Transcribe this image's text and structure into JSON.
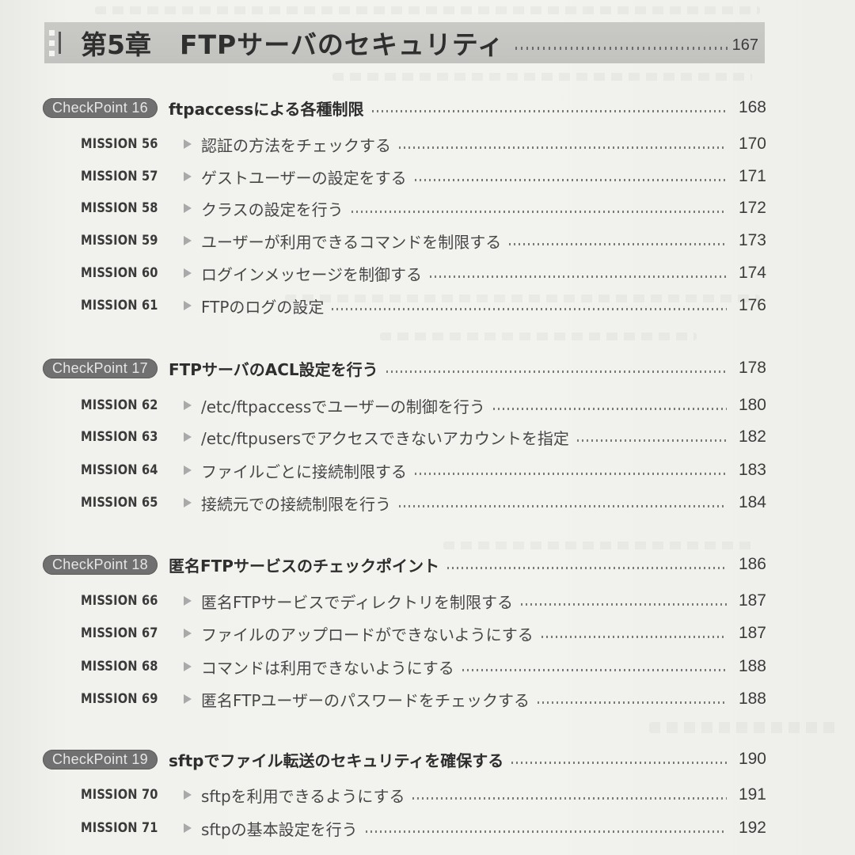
{
  "chapter": {
    "number_label": "第5章",
    "title": "FTPサーバのセキュリティ",
    "page": "167"
  },
  "checkpoints": [
    {
      "badge": "CheckPoint 16",
      "title": "ftpaccessによる各種制限",
      "page": "168",
      "missions": [
        {
          "label": "MISSION 56",
          "title": "認証の方法をチェックする",
          "page": "170"
        },
        {
          "label": "MISSION 57",
          "title": "ゲストユーザーの設定をする",
          "page": "171"
        },
        {
          "label": "MISSION 58",
          "title": "クラスの設定を行う",
          "page": "172"
        },
        {
          "label": "MISSION 59",
          "title": "ユーザーが利用できるコマンドを制限する",
          "page": "173"
        },
        {
          "label": "MISSION 60",
          "title": "ログインメッセージを制御する",
          "page": "174"
        },
        {
          "label": "MISSION 61",
          "title": "FTPのログの設定",
          "page": "176"
        }
      ]
    },
    {
      "badge": "CheckPoint 17",
      "title": "FTPサーバのACL設定を行う",
      "page": "178",
      "missions": [
        {
          "label": "MISSION 62",
          "title": "/etc/ftpaccessでユーザーの制御を行う",
          "page": "180"
        },
        {
          "label": "MISSION 63",
          "title": "/etc/ftpusersでアクセスできないアカウントを指定",
          "page": "182"
        },
        {
          "label": "MISSION 64",
          "title": "ファイルごとに接続制限する",
          "page": "183"
        },
        {
          "label": "MISSION 65",
          "title": "接続元での接続制限を行う",
          "page": "184"
        }
      ]
    },
    {
      "badge": "CheckPoint 18",
      "title": "匿名FTPサービスのチェックポイント",
      "page": "186",
      "missions": [
        {
          "label": "MISSION 66",
          "title": "匿名FTPサービスでディレクトリを制限する",
          "page": "187"
        },
        {
          "label": "MISSION 67",
          "title": "ファイルのアップロードができないようにする",
          "page": "187"
        },
        {
          "label": "MISSION 68",
          "title": "コマンドは利用できないようにする",
          "page": "188"
        },
        {
          "label": "MISSION 69",
          "title": "匿名FTPユーザーのパスワードをチェックする",
          "page": "188"
        }
      ]
    },
    {
      "badge": "CheckPoint 19",
      "title": "sftpでファイル転送のセキュリティを確保する",
      "page": "190",
      "missions": [
        {
          "label": "MISSION 70",
          "title": "sftpを利用できるようにする",
          "page": "191"
        },
        {
          "label": "MISSION 71",
          "title": "sftpの基本設定を行う",
          "page": "192"
        }
      ]
    }
  ]
}
